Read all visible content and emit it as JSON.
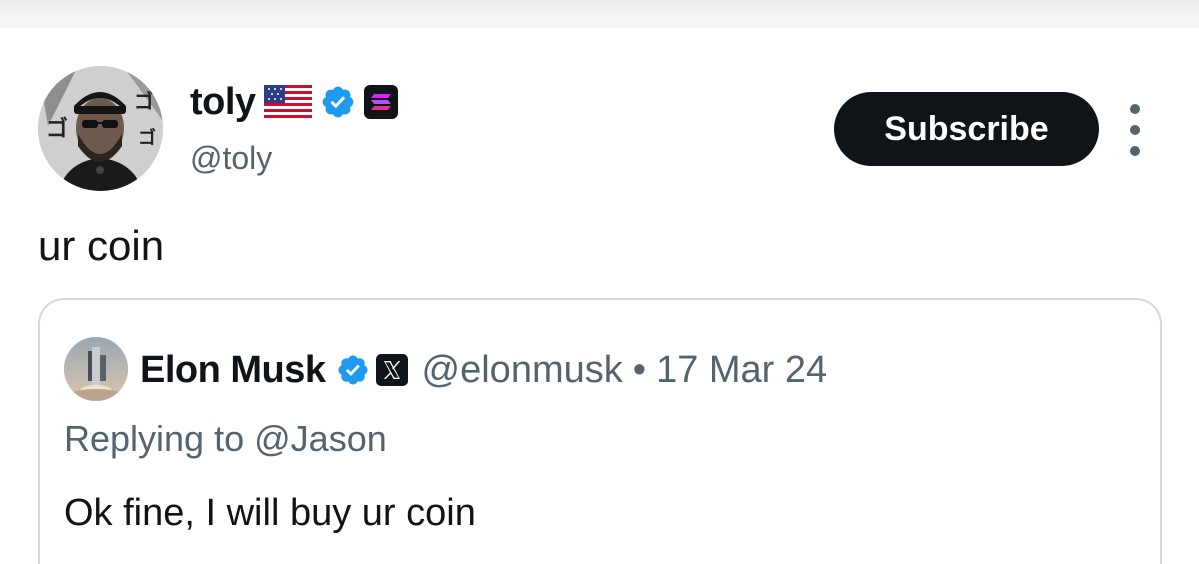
{
  "author": {
    "display_name": "toly",
    "handle": "@toly",
    "flag_icon": "us-flag-icon",
    "verified_icon": "verified-badge-icon",
    "affiliation_icon": "solana-logo-icon",
    "verified_color": "#1d9bf0"
  },
  "actions": {
    "subscribe_label": "Subscribe",
    "more_icon": "more-vertical-icon"
  },
  "tweet": {
    "text": "ur coin"
  },
  "quoted_tweet": {
    "display_name": "Elon Musk",
    "verified_icon": "verified-badge-icon",
    "affiliation_icon": "x-logo-icon",
    "handle": "@elonmusk",
    "separator": "•",
    "date": "17 Mar 24",
    "replying_prefix": "Replying to",
    "replying_to": "@Jason",
    "text": "Ok fine, I will buy ur coin"
  },
  "colors": {
    "text_primary": "#0f1419",
    "text_secondary": "#536471",
    "border": "#cfd9de",
    "button_bg": "#0f1419"
  }
}
